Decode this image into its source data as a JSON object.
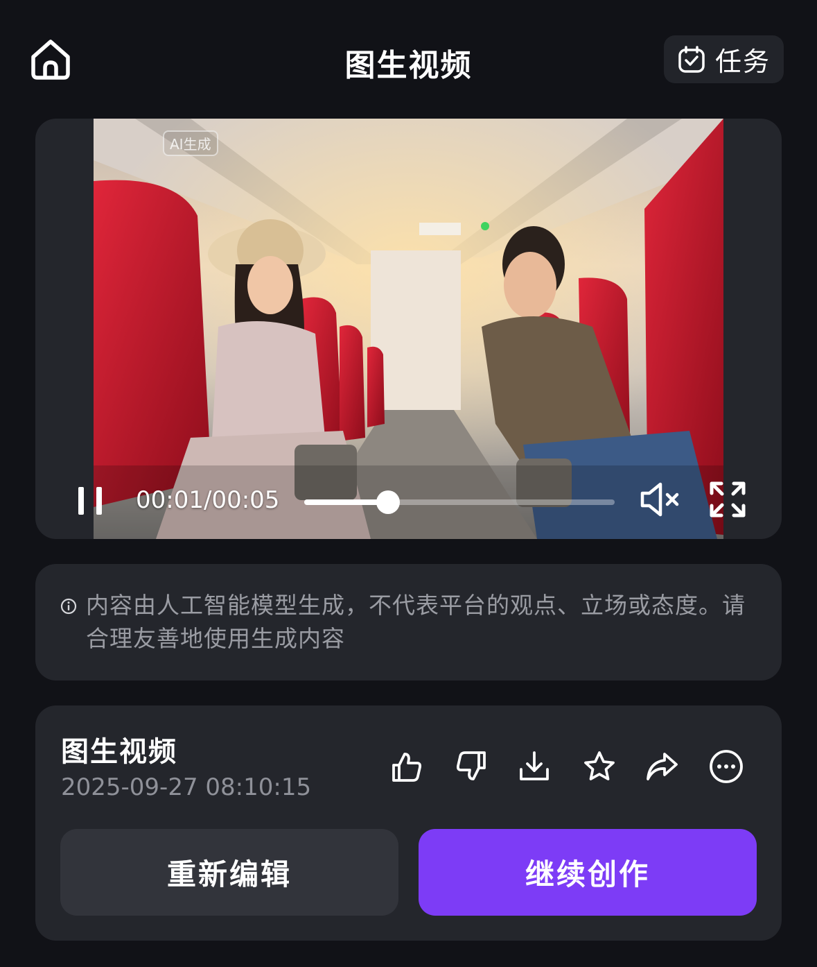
{
  "header": {
    "title": "图生视频",
    "task_label": "任务"
  },
  "video": {
    "badge": "AI生成",
    "time": "00:01/00:05",
    "progress": 0.27,
    "muted": true
  },
  "notice": {
    "text": "内容由人工智能模型生成，不代表平台的观点、立场或态度。请合理友善地使用生成内容"
  },
  "info": {
    "title": "图生视频",
    "date": "2025-09-27 08:10:15",
    "actions": [
      "thumbs-up",
      "thumbs-down",
      "download",
      "favorite",
      "share",
      "more"
    ],
    "reedit_label": "重新编辑",
    "continue_label": "继续创作"
  },
  "colors": {
    "background": "#111217",
    "card": "#24262c",
    "accent": "#7d3cf6",
    "secondary_button": "#32343b"
  }
}
